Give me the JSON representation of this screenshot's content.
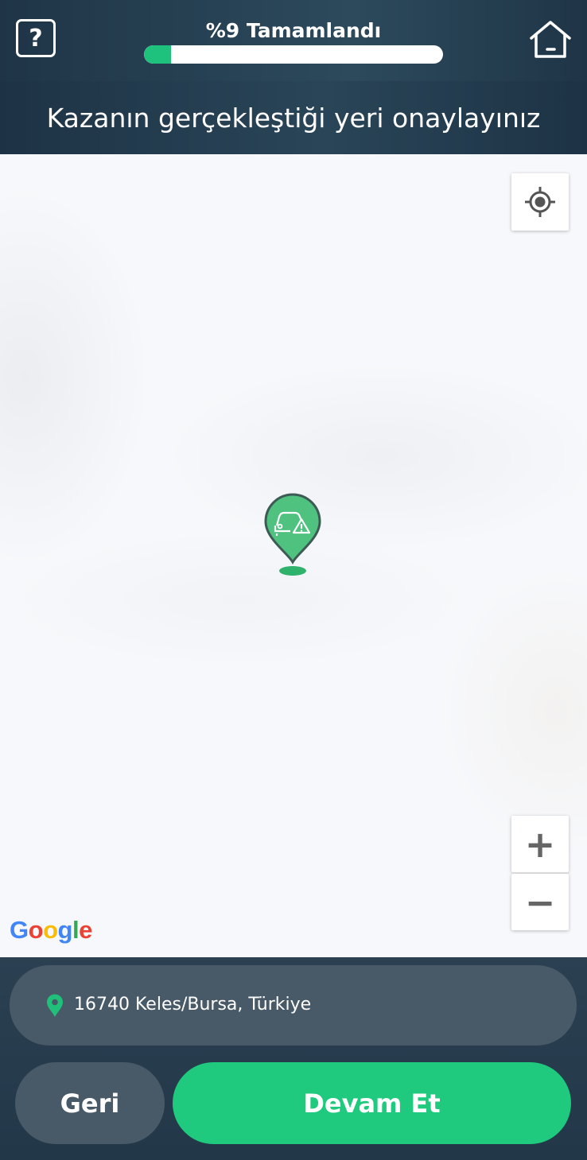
{
  "header": {
    "help_label": "?",
    "progress_label": "%9 Tamamlandı",
    "progress_fraction": 0.09,
    "home_icon": "home-icon"
  },
  "subheader": {
    "title": "Kazanın gerçekleştiği yeri onaylayınız"
  },
  "map": {
    "attribution": "Google",
    "locate_icon": "crosshair-icon",
    "zoom_in_label": "+",
    "zoom_out_label": "−",
    "marker_icon": "car-accident-pin-icon"
  },
  "bottom": {
    "address": "16740 Keles/Bursa, Türkiye",
    "back_label": "Geri",
    "next_label": "Devam Et"
  },
  "colors": {
    "accent": "#1fc97d",
    "header_bg": "#22384a",
    "pill_bg": "#485967"
  }
}
